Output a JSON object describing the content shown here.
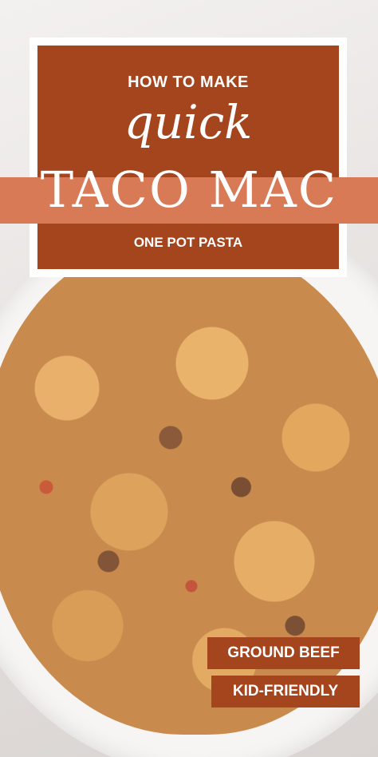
{
  "card": {
    "line1": "HOW TO MAKE",
    "line2": "quick",
    "line3": "TACO MAC",
    "line4": "ONE POT PASTA"
  },
  "badges": [
    "GROUND BEEF",
    "KID-FRIENDLY"
  ],
  "colors": {
    "card": "#a5451d",
    "band": "#d77a55",
    "badge": "#a5451d",
    "frame": "#ffffff"
  }
}
